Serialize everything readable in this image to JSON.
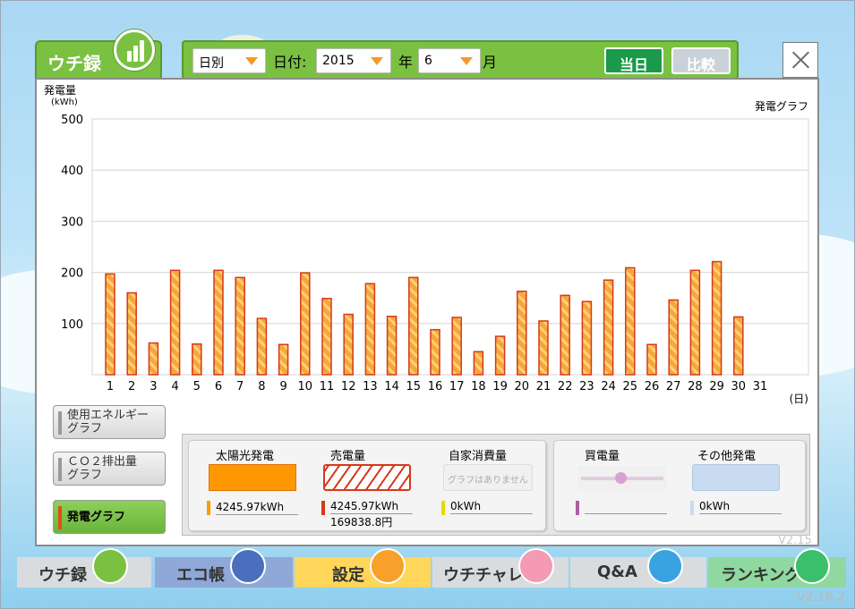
{
  "app": {
    "tab_label": "ウチ録",
    "close_label": "×",
    "version": "V2.16.2",
    "version_inner": "V2.15"
  },
  "toolbar": {
    "mode": "日別",
    "date_label": "日付:",
    "year": "2015",
    "year_suffix": "年",
    "month": "6",
    "month_suffix": "月",
    "today_label": "当日",
    "compare_label": "比較"
  },
  "chart_data": {
    "type": "bar",
    "title": "発電グラフ",
    "ylabel": "発電量",
    "yunit": "(kWh)",
    "xunit": "(日)",
    "ylim": [
      0,
      500
    ],
    "yticks": [
      100,
      200,
      300,
      400,
      500
    ],
    "categories": [
      "1",
      "2",
      "3",
      "4",
      "5",
      "6",
      "7",
      "8",
      "9",
      "10",
      "11",
      "12",
      "13",
      "14",
      "15",
      "16",
      "17",
      "18",
      "19",
      "20",
      "21",
      "22",
      "23",
      "24",
      "25",
      "26",
      "27",
      "28",
      "29",
      "30",
      "31"
    ],
    "values": [
      197,
      160,
      62,
      204,
      60,
      204,
      190,
      110,
      59,
      199,
      149,
      118,
      178,
      114,
      190,
      88,
      112,
      45,
      75,
      163,
      105,
      155,
      143,
      185,
      209,
      59,
      146,
      204,
      221,
      113,
      null
    ],
    "colors": {
      "fill": "#f7a63a",
      "stripe": "#ffd27a",
      "border": "#d6381a",
      "grid": "#d6d6d6"
    }
  },
  "side_buttons": [
    {
      "label_1": "使用エネルギー",
      "label_2": "グラフ"
    },
    {
      "label_1": "ＣＯ２排出量",
      "label_2": "グラフ"
    },
    {
      "label_1": "発電グラフ",
      "label_2": ""
    }
  ],
  "legend": {
    "solar": {
      "title": "太陽光発電",
      "value": "4245.97kWh",
      "color": "#ff9800"
    },
    "sell": {
      "title": "売電量",
      "value": "4245.97kWh",
      "value2": "169838.8円",
      "color": "#d6381a"
    },
    "self": {
      "title": "自家消費量",
      "note": "グラフはありません",
      "value": "0kWh",
      "color": "#e8d800"
    },
    "buy": {
      "title": "買電量",
      "value": "",
      "color": "#a85fa0"
    },
    "other": {
      "title": "その他発電",
      "value": "0kWh",
      "color": "#c8dbf0"
    }
  },
  "nav": {
    "items": [
      "ウチ録",
      "エコ帳",
      "設定",
      "ウチチャレ",
      "Q&A",
      "ランキング"
    ],
    "colors": [
      "#d8dcdf",
      "#8fa8d8",
      "#ffd659",
      "#d8dcdf",
      "#d8dcdf",
      "#8fd8a0"
    ]
  }
}
